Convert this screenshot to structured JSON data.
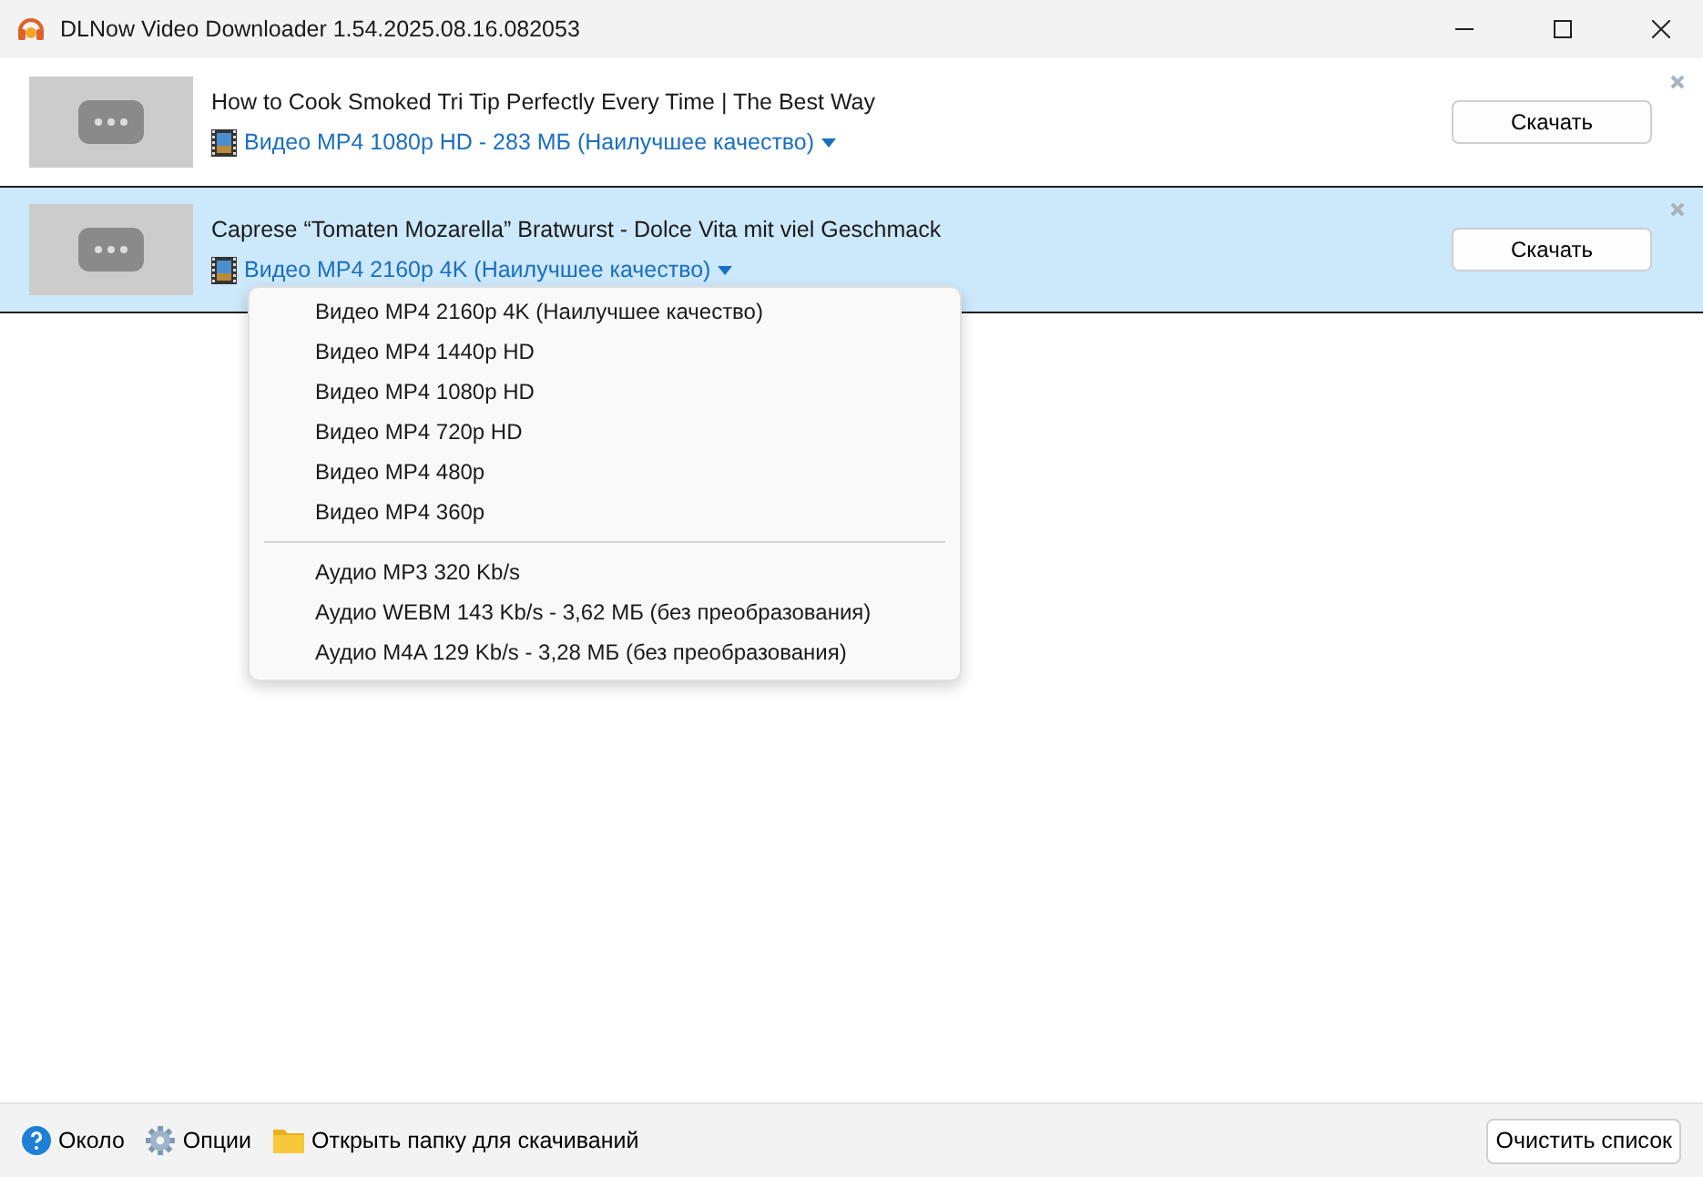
{
  "window": {
    "title": "DLNow Video Downloader 1.54.2025.08.16.082053"
  },
  "downloads": [
    {
      "title": "How to Cook Smoked Tri Tip Perfectly Every Time | The Best Way",
      "format": "Видео MP4 1080p HD - 283 МБ (Наилучшее качество)",
      "button": "Скачать",
      "selected": false,
      "menu_open": false
    },
    {
      "title": "Caprese “Tomaten Mozarella” Bratwurst - Dolce Vita mit viel Geschmack",
      "format": "Видео MP4 2160p 4K (Наилучшее качество)",
      "button": "Скачать",
      "selected": true,
      "menu_open": true
    }
  ],
  "format_menu": {
    "groups": [
      [
        "Видео MP4 2160p 4K (Наилучшее качество)",
        "Видео MP4 1440p HD",
        "Видео MP4 1080p HD",
        "Видео MP4 720p HD",
        "Видео MP4 480p",
        "Видео MP4 360p"
      ],
      [
        "Аудио MP3 320 Kb/s",
        "Аудио WEBM 143 Kb/s - 3,62 МБ (без преобразования)",
        "Аудио M4A 129 Kb/s - 3,28 МБ (без преобразования)"
      ]
    ]
  },
  "footer": {
    "links": [
      {
        "kind": "help",
        "label": "Около"
      },
      {
        "kind": "settings",
        "label": "Опции"
      },
      {
        "kind": "folder",
        "label": "Открыть папку для скачиваний"
      }
    ],
    "button": "Очистить список"
  }
}
